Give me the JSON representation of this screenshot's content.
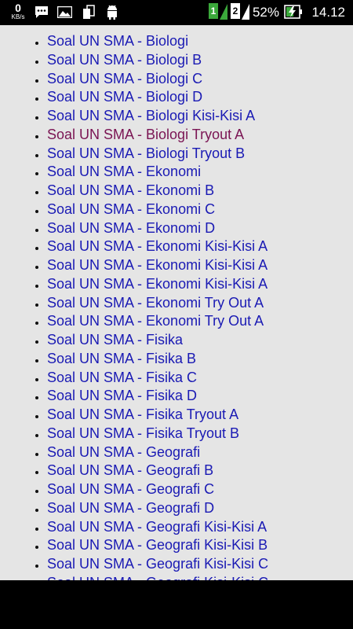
{
  "status_bar": {
    "net_speed_value": "0",
    "net_speed_unit": "KB/s",
    "sim1_label": "1",
    "sim2_label": "2",
    "battery_percent": "52%",
    "time": "14.12",
    "icons": [
      "messages-icon",
      "image-icon",
      "screen-transfer-icon",
      "android-debug-icon",
      "signal-sim1-icon",
      "signal-sim2-icon",
      "battery-charging-icon"
    ]
  },
  "colors": {
    "link": "#1a1ab4",
    "visited_link": "#7a1453",
    "page_background": "#e5e5e5"
  },
  "links": [
    {
      "label": "Soal UN SMA - Biologi",
      "visited": false
    },
    {
      "label": "Soal UN SMA - Biologi B",
      "visited": false
    },
    {
      "label": "Soal UN SMA - Biologi C",
      "visited": false
    },
    {
      "label": "Soal UN SMA - Biologi D",
      "visited": false
    },
    {
      "label": "Soal UN SMA - Biologi Kisi-Kisi A",
      "visited": false
    },
    {
      "label": "Soal UN SMA - Biologi Tryout A",
      "visited": true
    },
    {
      "label": "Soal UN SMA - Biologi Tryout B",
      "visited": false
    },
    {
      "label": "Soal UN SMA - Ekonomi",
      "visited": false
    },
    {
      "label": "Soal UN SMA - Ekonomi B",
      "visited": false
    },
    {
      "label": "Soal UN SMA - Ekonomi C",
      "visited": false
    },
    {
      "label": "Soal UN SMA - Ekonomi D",
      "visited": false
    },
    {
      "label": "Soal UN SMA - Ekonomi Kisi-Kisi A",
      "visited": false
    },
    {
      "label": "Soal UN SMA - Ekonomi Kisi-Kisi A",
      "visited": false
    },
    {
      "label": "Soal UN SMA - Ekonomi Kisi-Kisi A",
      "visited": false
    },
    {
      "label": "Soal UN SMA - Ekonomi Try Out A",
      "visited": false
    },
    {
      "label": "Soal UN SMA - Ekonomi Try Out A",
      "visited": false
    },
    {
      "label": "Soal UN SMA - Fisika",
      "visited": false
    },
    {
      "label": "Soal UN SMA - Fisika B",
      "visited": false
    },
    {
      "label": "Soal UN SMA - Fisika C",
      "visited": false
    },
    {
      "label": "Soal UN SMA - Fisika D",
      "visited": false
    },
    {
      "label": "Soal UN SMA - Fisika Tryout A",
      "visited": false
    },
    {
      "label": "Soal UN SMA - Fisika Tryout B",
      "visited": false
    },
    {
      "label": "Soal UN SMA - Geografi",
      "visited": false
    },
    {
      "label": "Soal UN SMA - Geografi B",
      "visited": false
    },
    {
      "label": "Soal UN SMA - Geografi C",
      "visited": false
    },
    {
      "label": "Soal UN SMA - Geografi D",
      "visited": false
    },
    {
      "label": "Soal UN SMA - Geografi Kisi-Kisi A",
      "visited": false
    },
    {
      "label": "Soal UN SMA - Geografi Kisi-Kisi B",
      "visited": false
    },
    {
      "label": "Soal UN SMA - Geografi Kisi-Kisi C",
      "visited": false
    },
    {
      "label": "Soal UN SMA - Geografi Kisi-Kisi C",
      "visited": false
    }
  ]
}
